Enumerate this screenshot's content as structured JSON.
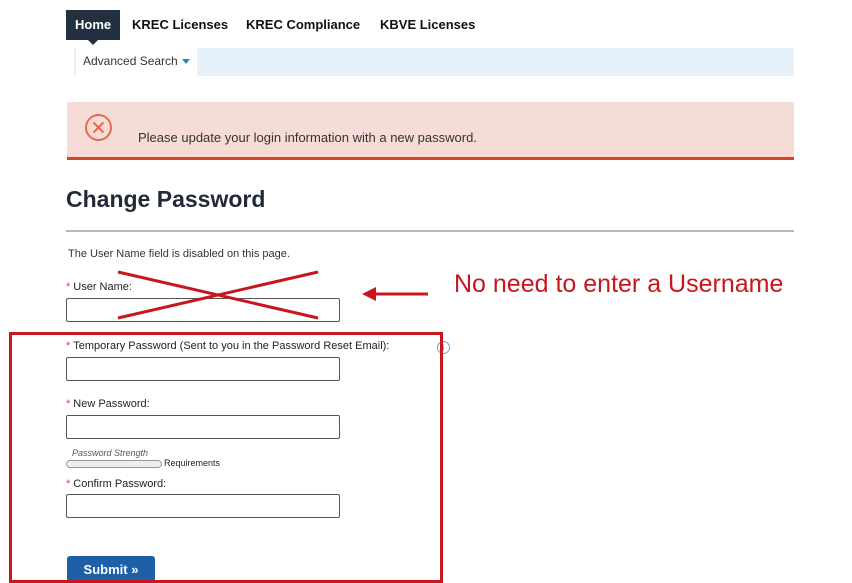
{
  "nav": {
    "tabs": [
      {
        "label": "Home",
        "active": true
      },
      {
        "label": "KREC Licenses"
      },
      {
        "label": "KREC Compliance"
      },
      {
        "label": "KBVE Licenses"
      }
    ],
    "sub_item": "Advanced Search"
  },
  "banner": {
    "message": "Please update your login information with a new password.",
    "icon": "error-circle-x-icon",
    "color": "#d9432a"
  },
  "page": {
    "title": "Change Password",
    "info": "The User Name field is disabled on this page."
  },
  "form": {
    "required_marker": "*",
    "username_label": "User Name:",
    "temp_password_label": "Temporary Password (Sent to you in the Password Reset Email):",
    "new_password_label": "New Password:",
    "strength_label": "Password Strength",
    "requirements_label": "Requirements",
    "confirm_password_label": "Confirm Password:",
    "submit_label": "Submit »",
    "username_value": "",
    "temp_password_value": "",
    "new_password_value": "",
    "confirm_password_value": ""
  },
  "annotation": {
    "text": "No need to enter a Username",
    "color": "#c8161d"
  }
}
